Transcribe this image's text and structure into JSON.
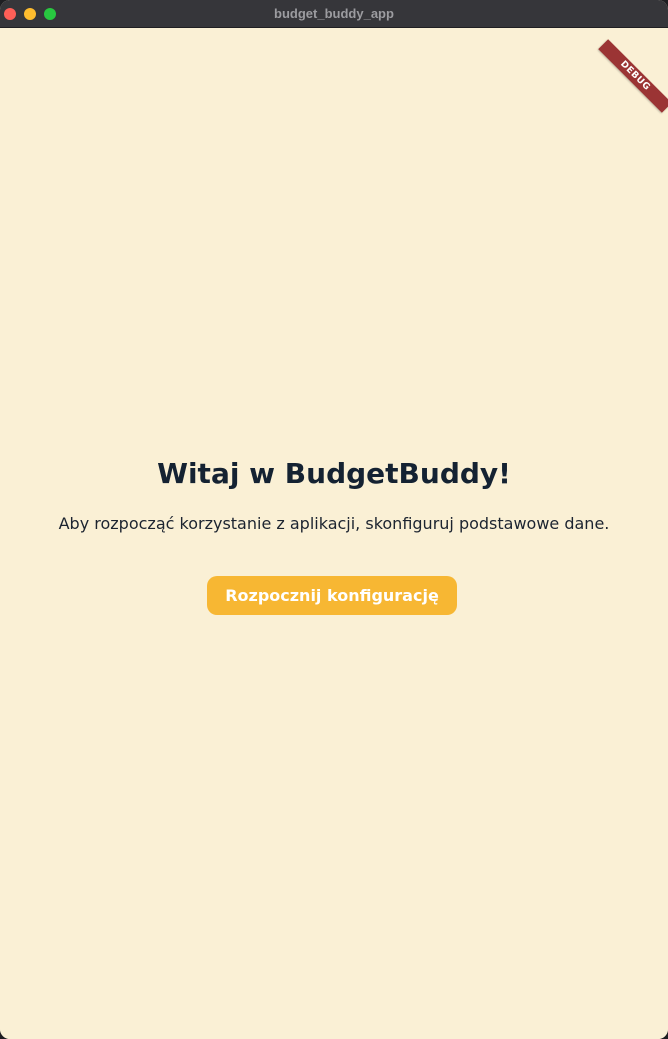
{
  "window": {
    "title": "budget_buddy_app"
  },
  "debug_banner": {
    "label": "DEBUG"
  },
  "welcome": {
    "heading": "Witaj w BudgetBuddy!",
    "description": "Aby rozpocząć korzystanie z aplikacji, skonfiguruj podstawowe dane.",
    "start_button_label": "Rozpocznij konfigurację"
  },
  "colors": {
    "background": "#faf0d5",
    "accent": "#f7b733",
    "heading_text": "#142232",
    "debug_banner": "#9b3434"
  }
}
